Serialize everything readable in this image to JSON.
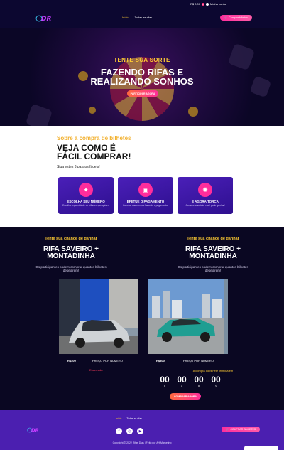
{
  "header": {
    "cart_value": "R$ 0,00",
    "cart_count": "0",
    "account_label": "Minha conta",
    "logo_text": "DR",
    "nav": [
      {
        "label": "Início"
      },
      {
        "label": "Todas as rifas"
      }
    ],
    "cta_label": "Comprar bilhetes"
  },
  "hero": {
    "kicker": "TENTE SUA SORTE",
    "title_line1": "FAZENDO RIFAS E",
    "title_line2": "REALIZANDO SONHOS",
    "button_label": "PARTICIPAR AGORA"
  },
  "steps": {
    "kicker": "Sobre a compra de bilhetes",
    "title_line1": "VEJA COMO É",
    "title_line2": "FÁCIL COMPRAR!",
    "subtitle": "Siga estes 3 passos fáceis!",
    "cards": [
      {
        "title": "ESCOLHA SEU NÚMERO",
        "desc": "Escolha a quantidade de bilhetes que quiser!",
        "icon": "ticket-icon"
      },
      {
        "title": "EFETUE O PAGAMENTO",
        "desc": "Conclua sua compra fazendo o pagamento.",
        "icon": "wallet-icon"
      },
      {
        "title": "E AGORA TORÇA",
        "desc": "Comece a sorteio, você pode ganhar!",
        "icon": "trophy-icon"
      }
    ]
  },
  "raffles": [
    {
      "kicker": "Tente sua chance de ganhar",
      "title_line1": "RIFA SAVEIRO +",
      "title_line2": "MONTADINHA",
      "desc": "Os participantes podem comprar quantos bilhetes desejarem!",
      "price": "R$300",
      "per_number": "PREÇO POR NUMERO",
      "status": "Encerrada"
    },
    {
      "kicker": "Tente sua chance de ganhar",
      "title_line1": "RIFA SAVEIRO +",
      "title_line2": "MONTADINHA",
      "desc": "Os participantes podem comprar quantos bilhetes desejarem!",
      "price": "R$300",
      "per_number": "PREÇO POR NUMERO",
      "countdown_label": "A compra do bilhete termina em",
      "countdown": [
        {
          "value": "00",
          "unit": "D"
        },
        {
          "value": "00",
          "unit": "H"
        },
        {
          "value": "00",
          "unit": "M"
        },
        {
          "value": "00",
          "unit": "S"
        }
      ],
      "button_label": "COMPRAR AGORA"
    }
  ],
  "footer": {
    "nav": [
      {
        "label": "Início"
      },
      {
        "label": "Todas as rifas"
      }
    ],
    "cta_label": "COMPRAR BILHETES",
    "social": [
      "f",
      "◎",
      "▶"
    ],
    "copyright": "Copyright © 2022 Rifas Dias | Feito por AH Marketing"
  },
  "colors": {
    "accent": "#ffcc33",
    "brand": "#ff2d9c",
    "footer": "#4b1fb0"
  }
}
